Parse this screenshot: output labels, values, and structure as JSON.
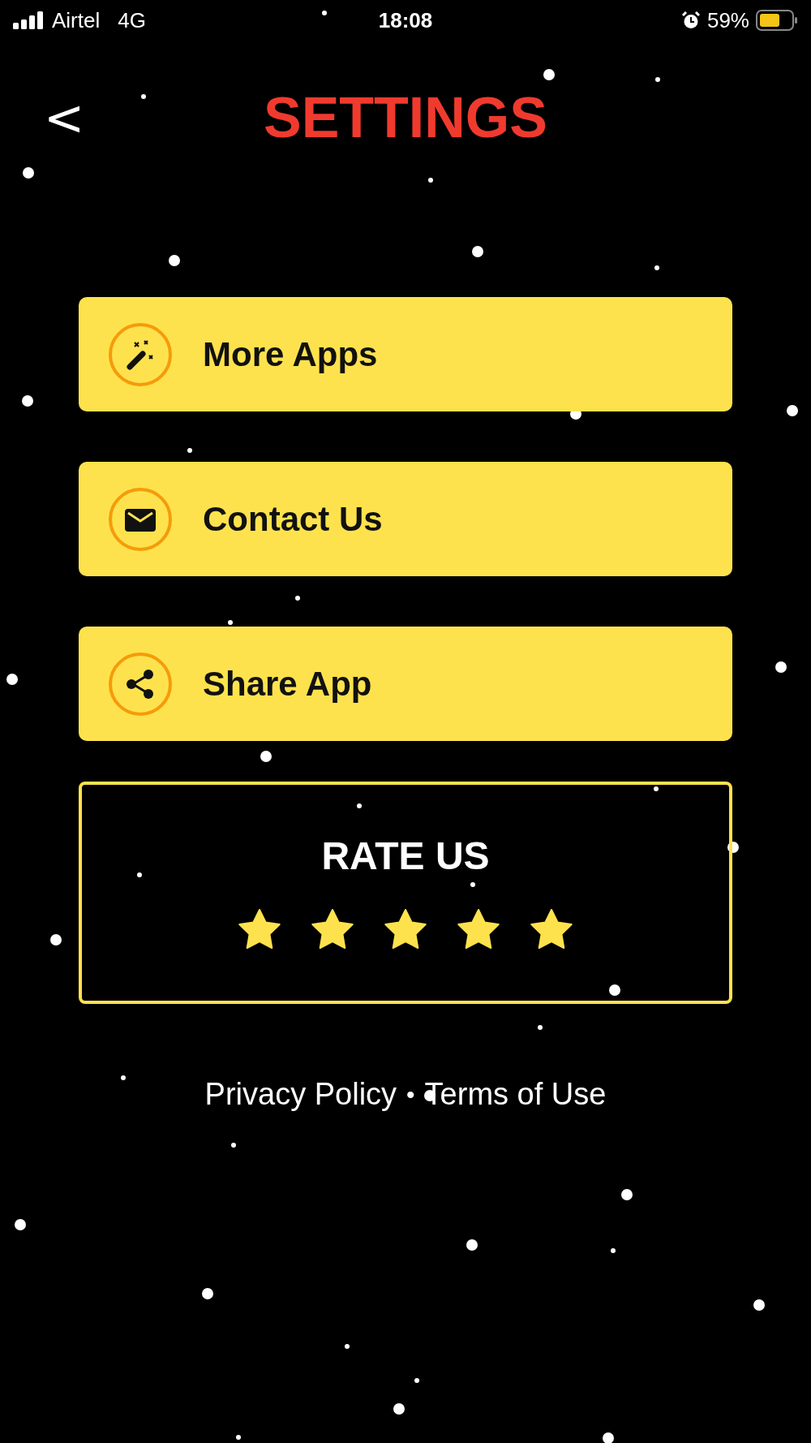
{
  "status_bar": {
    "carrier": "Airtel",
    "network": "4G",
    "time": "18:08",
    "battery_percent": "59%"
  },
  "header": {
    "back_glyph": "<",
    "title": "SETTINGS"
  },
  "menu_items": [
    {
      "label": "More Apps",
      "kind": "wand"
    },
    {
      "label": "Contact Us",
      "kind": "mail"
    },
    {
      "label": "Share App",
      "kind": "share"
    }
  ],
  "rating": {
    "title": "RATE US",
    "stars": 5
  },
  "footer": {
    "links": [
      "Privacy Policy",
      "Terms of Use"
    ],
    "separator": "•"
  }
}
